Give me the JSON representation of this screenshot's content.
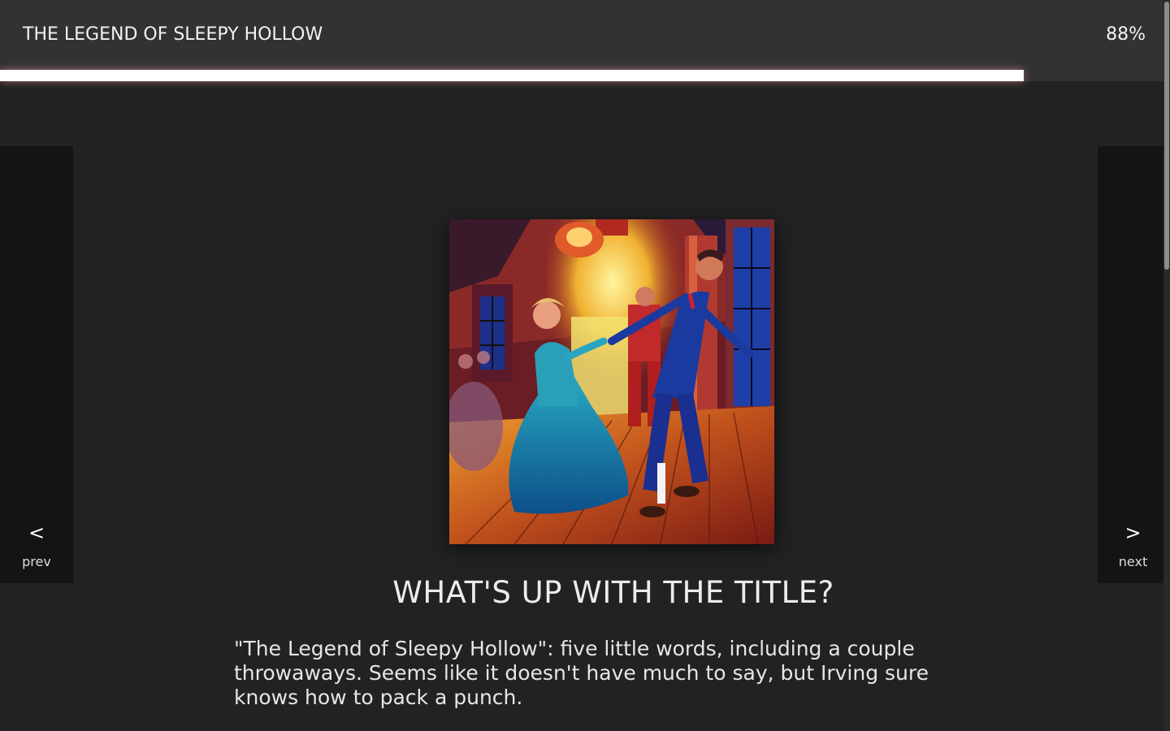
{
  "header": {
    "title": "THE LEGEND OF SLEEPY HOLLOW",
    "percent": "88%",
    "progress": 0.88
  },
  "nav": {
    "prev_arrow": "<",
    "prev_label": "prev",
    "next_arrow": ">",
    "next_label": "next"
  },
  "content": {
    "image_icon": "ballroom-dance-illustration",
    "heading": "WHAT'S UP WITH THE TITLE?",
    "paragraph": "\"The Legend of Sleepy Hollow\": five little words, including a couple throwaways. Seems like it doesn't have much to say, but Irving sure knows how to pack a punch."
  },
  "colors": {
    "background": "#222222",
    "header": "#323232",
    "nav": "#141414",
    "progress": "#ffffff"
  }
}
